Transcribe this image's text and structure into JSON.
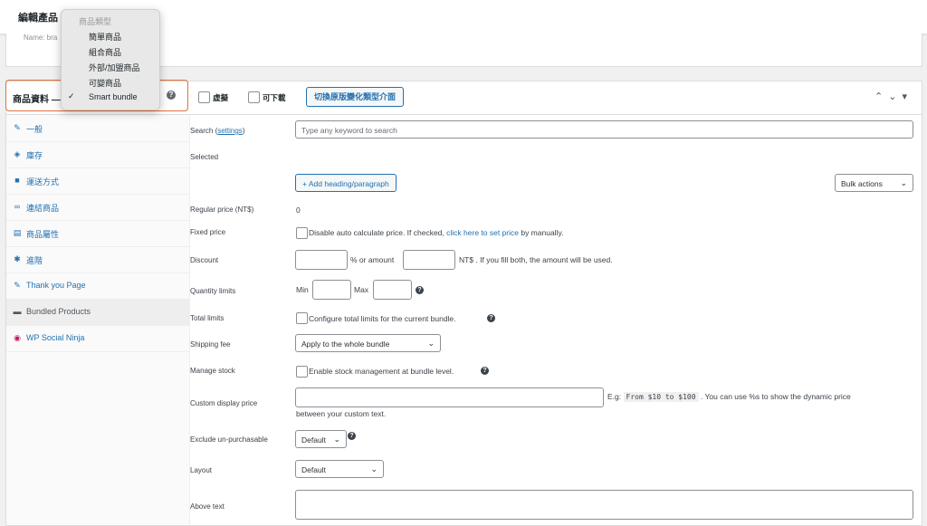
{
  "page": {
    "title": "編輯產品",
    "name_text": "Name: bra"
  },
  "product_data": {
    "title": "商品資料 —",
    "virtual_label": "虛擬",
    "downloadable_label": "可下載",
    "switch_button": "切換原版變化類型介面"
  },
  "type_menu": {
    "header": "商品類型",
    "options": [
      "簡單商品",
      "組合商品",
      "外部/加盟商品",
      "可變商品",
      "Smart bundle"
    ],
    "selected": "Smart bundle"
  },
  "sidebar": {
    "items": [
      {
        "label": "一般",
        "icon": "wrench-icon"
      },
      {
        "label": "庫存",
        "icon": "tag-icon"
      },
      {
        "label": "運送方式",
        "icon": "truck-icon"
      },
      {
        "label": "連結商品",
        "icon": "link-icon"
      },
      {
        "label": "商品屬性",
        "icon": "table-icon"
      },
      {
        "label": "進階",
        "icon": "gear-icon"
      },
      {
        "label": "Thank you Page",
        "icon": "wrench-icon"
      },
      {
        "label": "Bundled Products",
        "icon": "box-icon"
      },
      {
        "label": "WP Social Ninja",
        "icon": "ninja-icon"
      }
    ],
    "active": "Bundled Products"
  },
  "form": {
    "search": {
      "label": "Search (",
      "link": "settings",
      "label_end": ")",
      "placeholder": "Type any keyword to search"
    },
    "selected_label": "Selected",
    "add_heading_button": "+ Add heading/paragraph",
    "bulk_actions": "Bulk actions",
    "regular_price": {
      "label": "Regular price (NT$)",
      "value": "0"
    },
    "fixed_price": {
      "label": "Fixed price",
      "text_before": "Disable auto calculate price. If checked, ",
      "link": "click here to set price",
      "text_after": " by manually."
    },
    "discount": {
      "label": "Discount",
      "middle": "% or amount",
      "after": "NT$ . If you fill both, the amount will be used."
    },
    "quantity_limits": {
      "label": "Quantity limits",
      "min": "Min",
      "max": "Max"
    },
    "total_limits": {
      "label": "Total limits",
      "text": "Configure total limits for the current bundle."
    },
    "shipping_fee": {
      "label": "Shipping fee",
      "value": "Apply to the whole bundle"
    },
    "manage_stock": {
      "label": "Manage stock",
      "text": "Enable stock management at bundle level."
    },
    "custom_display_price": {
      "label": "Custom display price",
      "eg": "E.g:",
      "code": "From $10 to $100",
      "text": ". You can use %s to show the dynamic price",
      "text2": "between your custom text."
    },
    "exclude": {
      "label": "Exclude un-purchasable",
      "value": "Default"
    },
    "layout": {
      "label": "Layout",
      "value": "Default"
    },
    "above_text": {
      "label": "Above text"
    }
  },
  "colors": {
    "accent": "#2271b1",
    "highlight": "#e2703a"
  }
}
